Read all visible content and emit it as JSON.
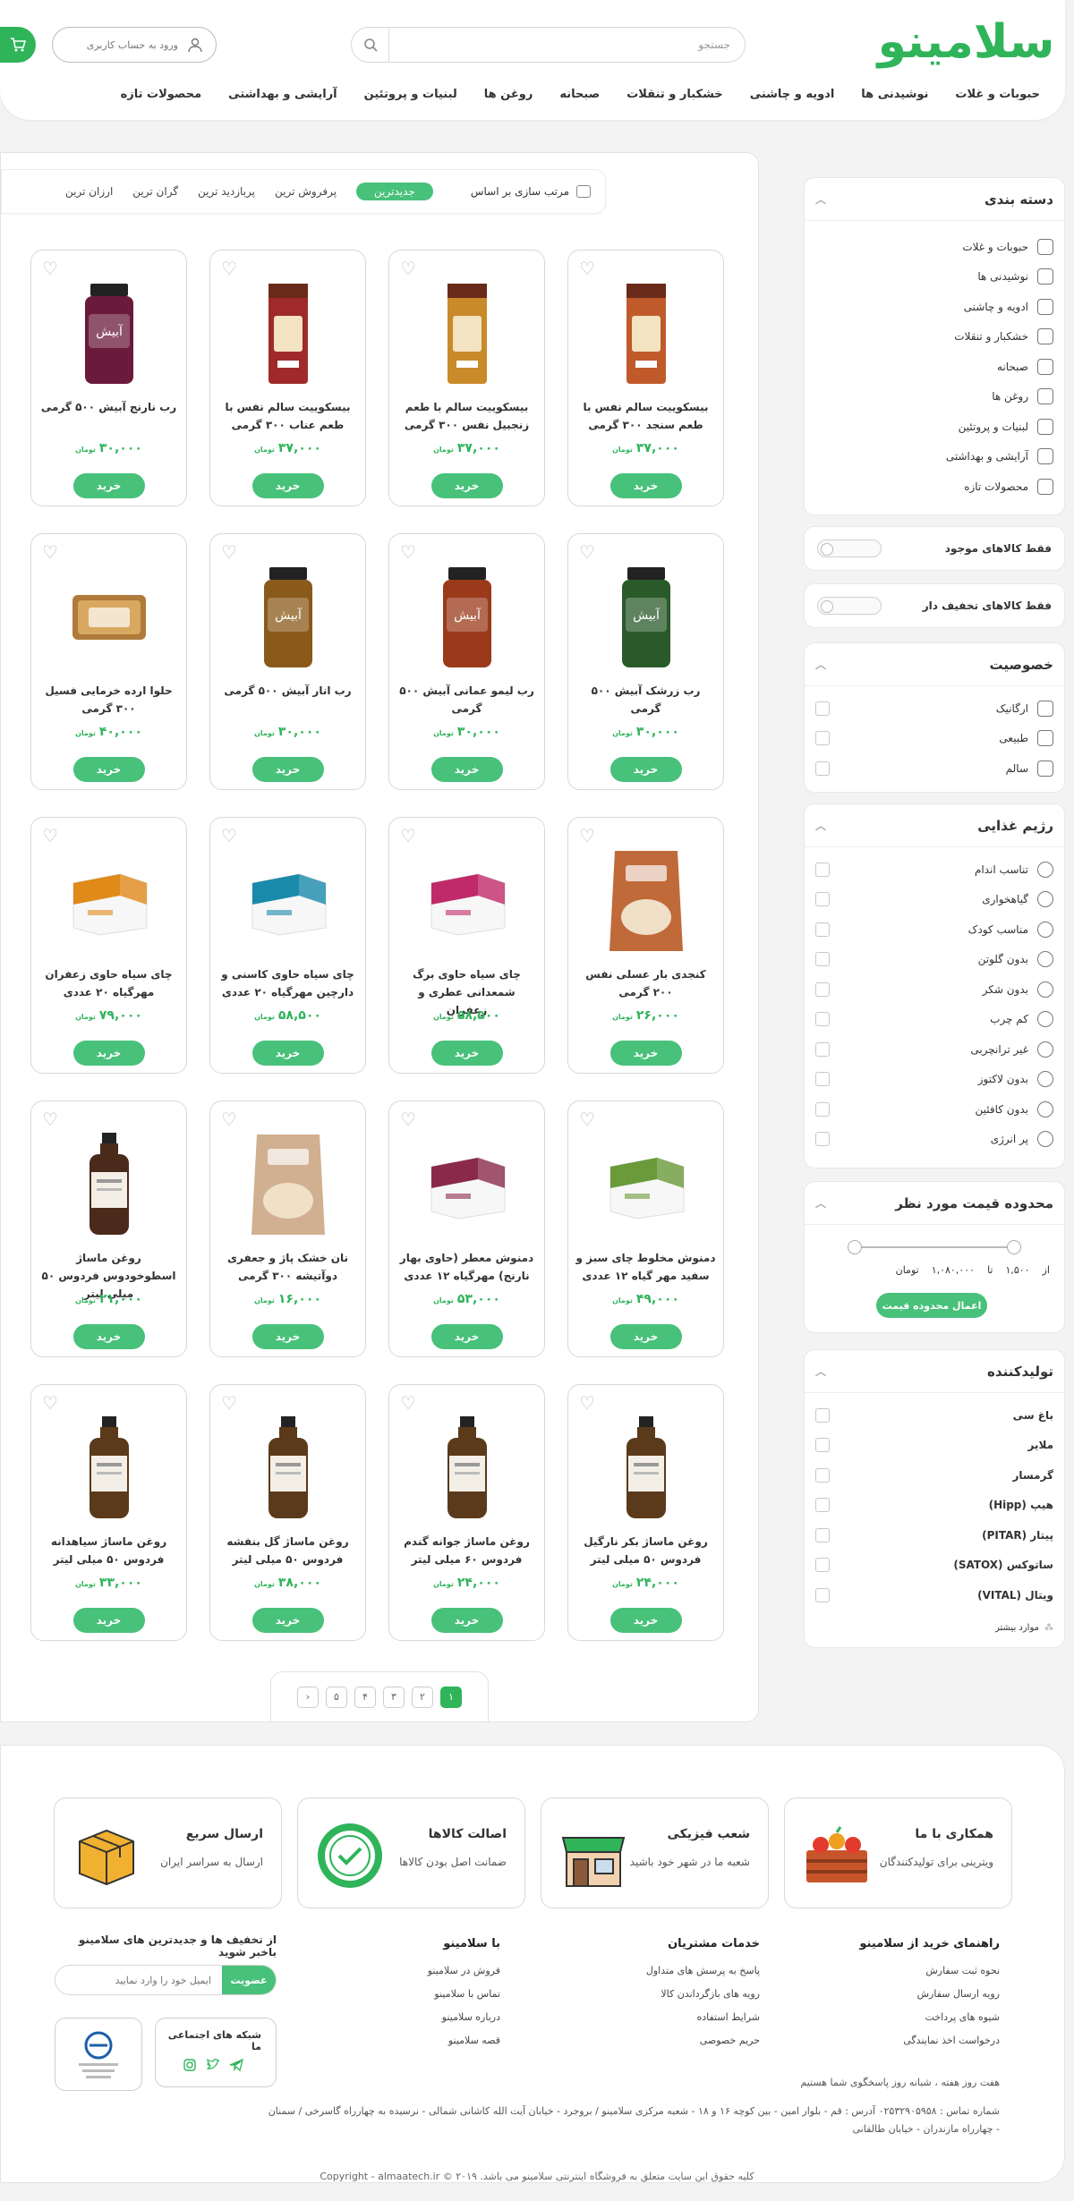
{
  "header": {
    "logo_text": "سلامینو",
    "search_placeholder": "جستجو",
    "login_label": "ورود به حساب کاربری",
    "nav": [
      "حبوبات و غلات",
      "نوشیدنی ها",
      "ادویه و چاشنی",
      "خشکبار و تنقلات",
      "صبحانه",
      "روغن ها",
      "لبنیات و پروتئین",
      "آرایشی و بهداشتی",
      "محصولات تازه"
    ]
  },
  "sidebar": {
    "categories_title": "دسته بندی",
    "categories": [
      "حبوبات و غلات",
      "نوشیدنی ها",
      "ادویه و چاشنی",
      "خشکبار و تنقلات",
      "صبحانه",
      "روغن ها",
      "لبنیات و پروتئین",
      "آرایشی و بهداشتی",
      "محصولات تازه"
    ],
    "available_only": "فقط کالاهای موجود",
    "discount_only": "فقط کالاهای تخفیف دار",
    "feature_title": "خصوصیت",
    "features": [
      "ارگانیک",
      "طبیعی",
      "سالم"
    ],
    "diet_title": "رژیم غذایی",
    "diets": [
      "تناسب اندام",
      "گیاهخواری",
      "مناسب کودک",
      "بدون گلوتن",
      "بدون شکر",
      "کم چرب",
      "غیر ترانچربی",
      "بدون لاکتوز",
      "بدون کافئین",
      "پر انرژی"
    ],
    "price_title": "محدوده قیمت مورد نظر",
    "price_from_label": "از",
    "price_min": "۱,۵۰۰",
    "price_to_label": "تا",
    "price_max": "۱,۰۸۰,۰۰۰",
    "price_unit": "تومان",
    "price_apply": "اعمال محدوده قیمت",
    "producer_title": "تولیدکننده",
    "producers": [
      "باغ سی",
      "ملایر",
      "گرمسار",
      "هیپ (Hipp)",
      "پیتار (PITAR)",
      "ساتوکس (SATOX)",
      "ویتال (VITAL)"
    ],
    "more_label": "موارد بیشتر"
  },
  "sort": {
    "label": "مرتب سازی بر اساس",
    "options": [
      "جدیدترین",
      "پرفروش ترین",
      "پربازدید ترین",
      "گران ترین",
      "ارزان ترین"
    ],
    "active": "جدیدترین"
  },
  "products": [
    {
      "name": "بیسکوییت سالم نفس با طعم سنجد ۳۰۰ گرمی",
      "price": "۳۷,۰۰۰",
      "img": "biscuit",
      "color": "#c05a2a"
    },
    {
      "name": "بیسکوییت سالم با طعم زنجبیل نفس ۳۰۰ گرمی",
      "price": "۳۷,۰۰۰",
      "img": "biscuit",
      "color": "#c98a2a"
    },
    {
      "name": "بیسکوییت سالم نفس با طعم عناب ۳۰۰ گرمی",
      "price": "۳۷,۰۰۰",
      "img": "biscuit",
      "color": "#a02a2a"
    },
    {
      "name": "رب نارنج آبیش ۵۰۰ گرمی",
      "price": "۳۰,۰۰۰",
      "img": "jar",
      "color": "#6a1a3a"
    },
    {
      "name": "رب زرشک آبیش ۵۰۰ گرمی",
      "price": "۳۰,۰۰۰",
      "img": "jar",
      "color": "#2a5a2a"
    },
    {
      "name": "رب لیمو عمانی آبیش ۵۰۰ گرمی",
      "price": "۳۰,۰۰۰",
      "img": "jar",
      "color": "#9a3a1a"
    },
    {
      "name": "رب انار آبیش ۵۰۰ گرمی",
      "price": "۳۰,۰۰۰",
      "img": "jar",
      "color": "#8a5a1a"
    },
    {
      "name": "حلوا ارده خرمایی فسیل ۳۰۰ گرمی",
      "price": "۴۰,۰۰۰",
      "img": "tray",
      "color": "#b07a3a"
    },
    {
      "name": "کنجدی بار عسلی نفس ۲۰۰ گرمی",
      "price": "۲۶,۰۰۰",
      "img": "bag",
      "color": "#c06a3a"
    },
    {
      "name": "چای سیاه حاوی برگ شمعدانی عطری و زعفران",
      "price": "۵۸,۵۰۰",
      "img": "box",
      "color": "#c02a6a"
    },
    {
      "name": "چای سیاه حاوی کاسنی و دارچین مهرگیاه ۲۰ عددی",
      "price": "۵۸,۵۰۰",
      "img": "box",
      "color": "#1a8aaa"
    },
    {
      "name": "چای سیاه حاوی زعفران مهرگیاه ۲۰ عددی",
      "price": "۷۹,۰۰۰",
      "img": "box",
      "color": "#e08a1a"
    },
    {
      "name": "دمنوش مخلوط چای سبز و سفید مهر گیاه ۱۲ عددی",
      "price": "۴۹,۰۰۰",
      "img": "box",
      "color": "#6a9a3a"
    },
    {
      "name": "دمنوش معطر (حاوی بهار نارنج) مهرگیاه ۱۲ عددی",
      "price": "۵۳,۰۰۰",
      "img": "box",
      "color": "#8a2a4a"
    },
    {
      "name": "نان خشک پاژ و جعفری دوآتیشه ۳۰۰ گرمی",
      "price": "۱۶,۰۰۰",
      "img": "bag",
      "color": "#d0b090"
    },
    {
      "name": "روغن ماساژ اسطوخودوس فردوس ۵۰ میلی لیتر",
      "price": "۲۱,۰۰۰",
      "img": "bottle",
      "color": "#4a2a1a"
    },
    {
      "name": "روغن ماساژ بکر نارگیل فردوس ۵۰ میلی لیتر",
      "price": "۲۴,۰۰۰",
      "img": "bottle",
      "color": "#5a3a1a"
    },
    {
      "name": "روغن ماساژ جوانه گندم فردوس ۶۰ میلی لیتر",
      "price": "۲۴,۰۰۰",
      "img": "bottle",
      "color": "#5a3a1a"
    },
    {
      "name": "روغن ماساژ گل بنفشه فردوس ۵۰ میلی لیتر",
      "price": "۳۸,۰۰۰",
      "img": "bottle",
      "color": "#5a3a1a"
    },
    {
      "name": "روغن ماساژ سیاهدانه فردوس ۵۰ میلی لیتر",
      "price": "۳۳,۰۰۰",
      "img": "bottle",
      "color": "#5a3a1a"
    }
  ],
  "currency_label": "تومان",
  "buy_label": "خرید",
  "pagination": [
    "۱",
    "۲",
    "۳",
    "۴",
    "۵"
  ],
  "footer": {
    "features": [
      {
        "title": "همکاری با ما",
        "sub": "ویترینی برای تولیدکنندگان"
      },
      {
        "title": "شعب فیزیکی",
        "sub": "شعبه ما در شهر خود باشید"
      },
      {
        "title": "اصالت کالاها",
        "sub": "ضمانت اصل بودن کالاها"
      },
      {
        "title": "ارسال سریع",
        "sub": "ارسال به سراسر ایران"
      }
    ],
    "col1_title": "راهنمای خرید از سلامینو",
    "col1": [
      "نحوه ثبت سفارش",
      "رویه ارسال سفارش",
      "شیوه های پرداخت",
      "درخواست اخذ نمایندگی"
    ],
    "col2_title": "خدمات مشتریان",
    "col2": [
      "پاسخ به پرسش های متداول",
      "رویه های بازگرداندن کالا",
      "شرایط استفاده",
      "حریم خصوصی"
    ],
    "col3_title": "با سلامینو",
    "col3": [
      "فروش در سلامینو",
      "تماس با سلامینو",
      "درباره سلامینو",
      "قصه سلامینو"
    ],
    "newsletter_title": "از تخفیف ها و جدیدترین های سلامینو باخبر شوید",
    "newsletter_placeholder": "ایمیل خود را وارد نمایید",
    "newsletter_button": "عضویت",
    "social_title": "شبکه های اجتماعی ما",
    "hours": "هفت روز هفته ، شبانه روز پاسخگوی شما هستیم",
    "address_line1": "شماره تماس : ۰۲۵۳۲۹۰۵۹۵۸ آدرس : قم - بلوار امین - بین کوچه ۱۶ و ۱۸ - شعبه مرکزی سلامینو / بروجرد - خیابان آیت الله کاشانی شمالی - نرسیده به چهارراه گاسرخی / سمنان",
    "address_line2": "- چهارراه مازندران - خیابان طالقانی",
    "copyright": "کلیه حقوق این سایت متعلق به فروشگاه اینترنتی سلامینو می باشد.  Copyright - almaatech.ir © ۲۰۱۹"
  },
  "colors": {
    "brand": "#2fb45a",
    "button": "#48c17a"
  }
}
